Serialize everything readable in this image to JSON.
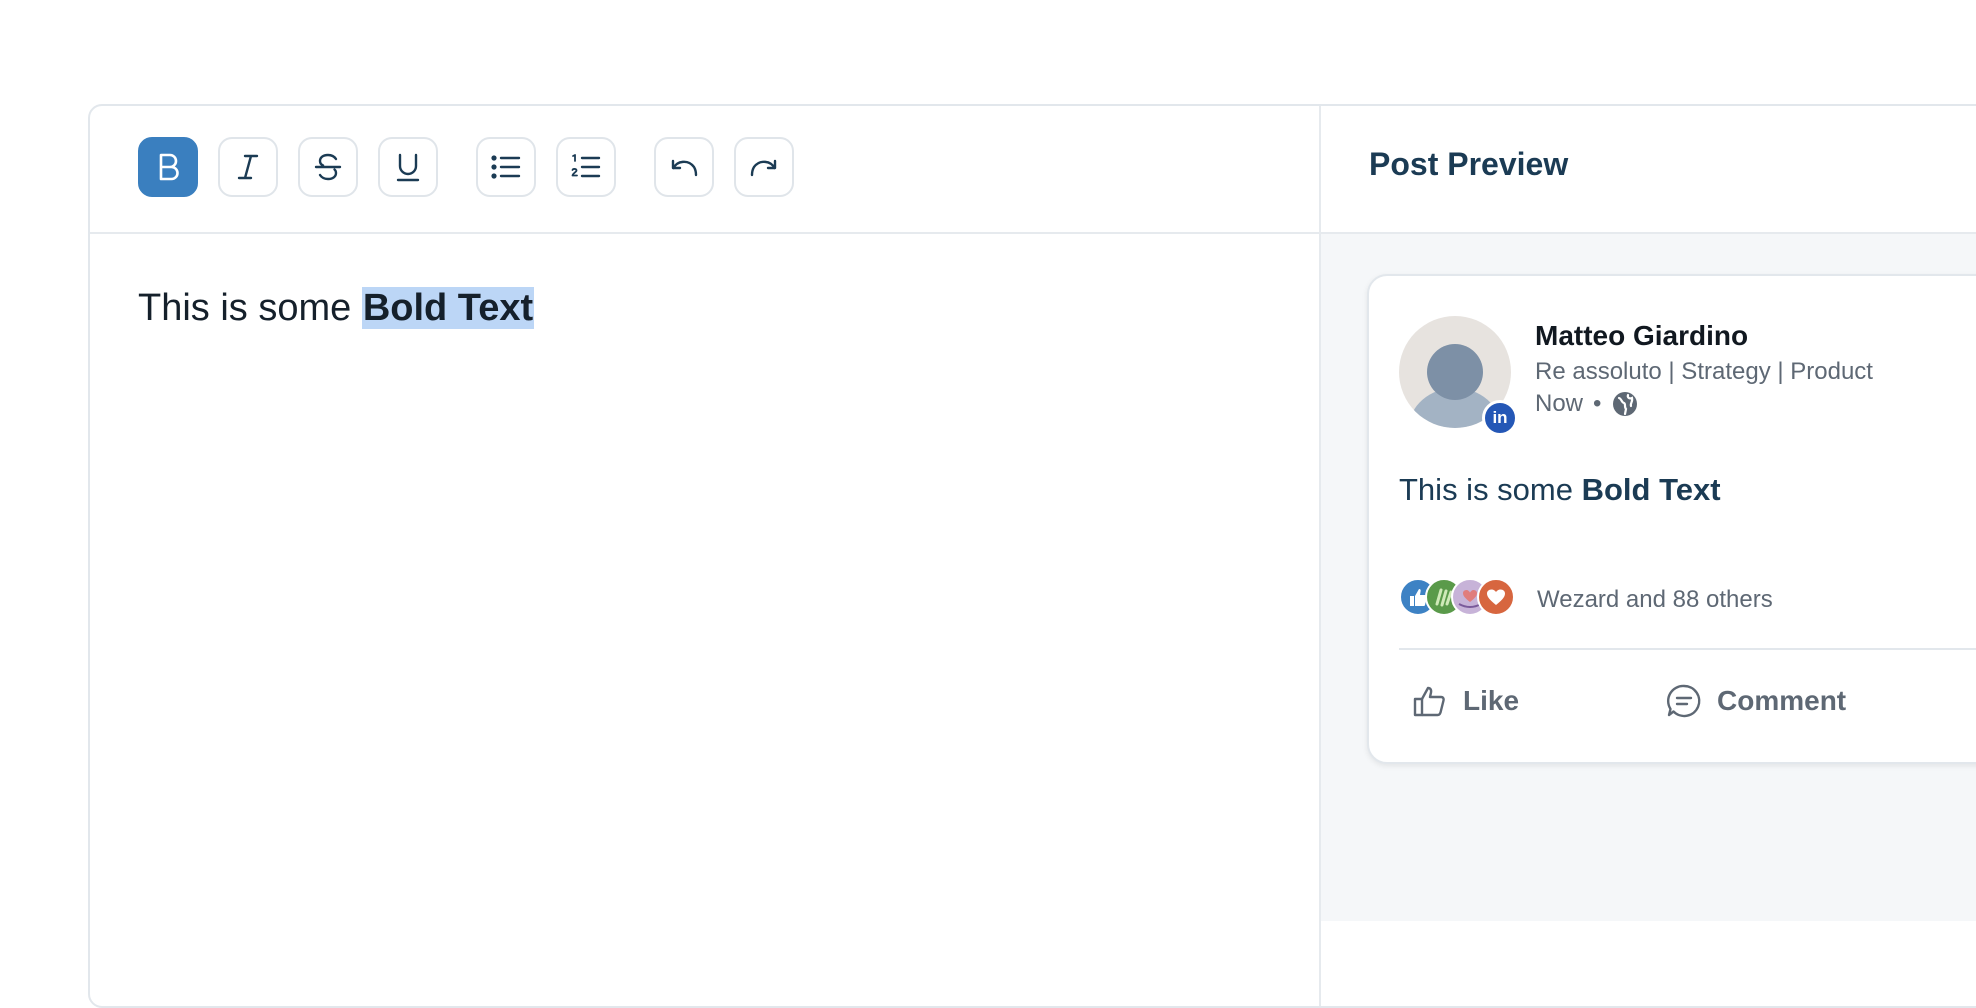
{
  "toolbar": {
    "buttons": [
      {
        "name": "bold",
        "icon": "bold-icon",
        "active": true
      },
      {
        "name": "italic",
        "icon": "italic-icon"
      },
      {
        "name": "strikethrough",
        "icon": "strikethrough-icon"
      },
      {
        "name": "underline",
        "icon": "underline-icon"
      },
      {
        "name": "bulleted-list",
        "icon": "bullet-list-icon"
      },
      {
        "name": "numbered-list",
        "icon": "numbered-list-icon"
      },
      {
        "name": "undo",
        "icon": "undo-icon"
      },
      {
        "name": "redo",
        "icon": "redo-icon"
      }
    ]
  },
  "editor": {
    "text_plain": "This is some ",
    "text_bold_selected": "Bold Text"
  },
  "preview": {
    "title": "Post Preview",
    "author": "Matteo Giardino",
    "headline": "Re assoluto | Strategy | Product",
    "time": "Now",
    "separator": "•",
    "badge": "in",
    "post_plain": "This is some ",
    "post_bold": "Bold Text",
    "reactions_text": "Wezard and 88 others",
    "actions": {
      "like": "Like",
      "comment": "Comment"
    }
  },
  "colors": {
    "accent": "#3a7fbf",
    "selection": "#bcd6f6",
    "linkedin_badge": "#2457b6",
    "heading": "#1b3b54"
  }
}
